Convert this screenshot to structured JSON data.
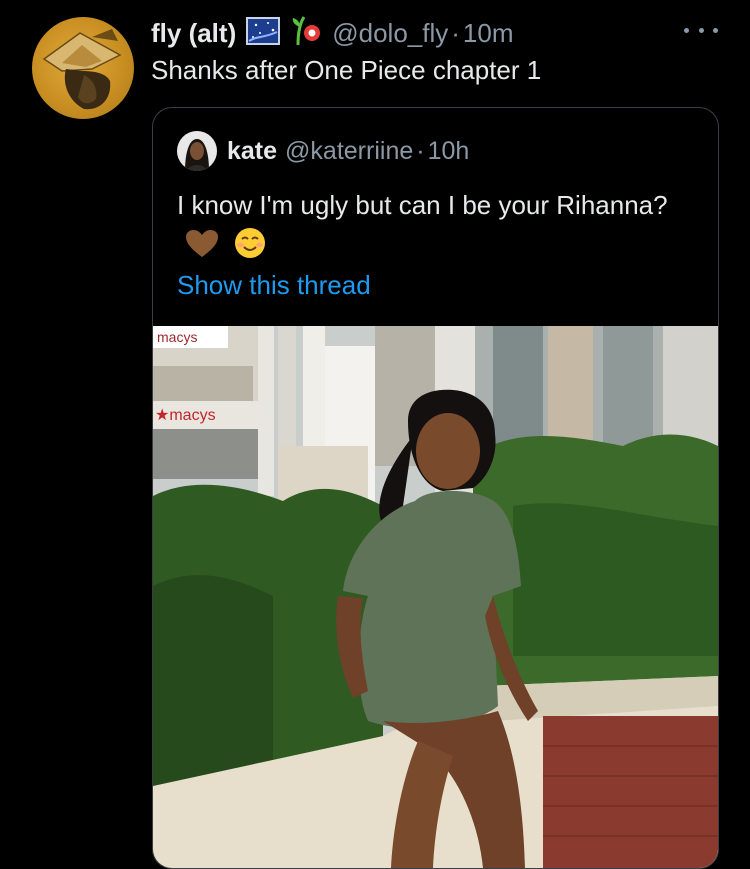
{
  "tweet": {
    "display_name": "fly (alt)",
    "handle": "@dolo_fly",
    "separator": "·",
    "time": "10m",
    "text": "Shanks after One Piece chapter 1",
    "avatar_icon": "straw-hat-avatar-icon",
    "badges": [
      "starry-night-emoji-icon",
      "plant-emoji-icon"
    ]
  },
  "quote": {
    "display_name": "kate",
    "handle": "@katerriine",
    "separator": "·",
    "time": "10h",
    "text": "I know I'm ugly but can I be your Rihanna?",
    "emojis": [
      "brown-heart-emoji-icon",
      "smiling-face-emoji-icon"
    ],
    "show_thread": "Show this thread",
    "photo": {
      "store_sign_top": "macys",
      "store_sign": "★macys"
    }
  },
  "colors": {
    "background": "#000000",
    "text_primary": "#e7e9ea",
    "text_secondary": "#8b98a5",
    "link": "#1d9bf0",
    "card_border": "#3a3f44"
  }
}
